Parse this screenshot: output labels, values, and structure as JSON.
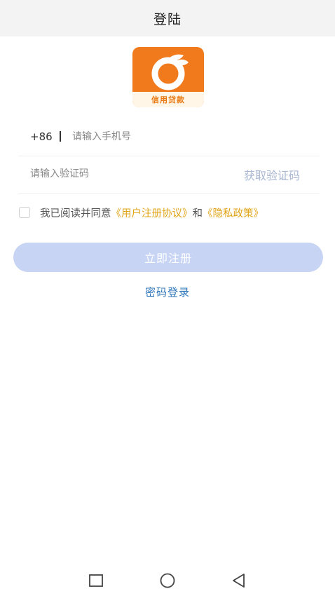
{
  "header": {
    "title": "登陆"
  },
  "logo": {
    "text": "信用贷款",
    "icon": "orange-fruit-icon"
  },
  "phone": {
    "prefix": "+86",
    "placeholder": "请输入手机号",
    "value": ""
  },
  "verification": {
    "placeholder": "请输入验证码",
    "value": "",
    "get_code_label": "获取验证码"
  },
  "agreement": {
    "checked": false,
    "text": "我已阅读并同意",
    "user_agreement": "《用户注册协议》",
    "and": "和",
    "privacy_policy": "《隐私政策》"
  },
  "actions": {
    "register_label": "立即注册",
    "password_login_label": "密码登录"
  },
  "navbar": {
    "recent_icon": "square-icon",
    "home_icon": "circle-icon",
    "back_icon": "triangle-back-icon"
  },
  "colors": {
    "accent_link": "#e0a417",
    "button_disabled": "#c8d4f4",
    "link_blue": "#2a73b8",
    "logo_orange": "#f07a1c"
  }
}
